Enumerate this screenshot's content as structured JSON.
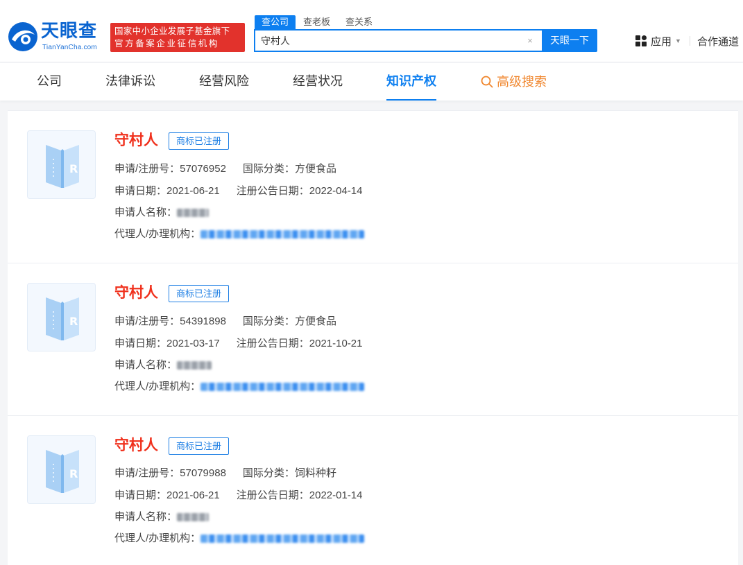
{
  "brand": {
    "name": "天眼查",
    "domain": "TianYanCha.com",
    "color": "#0a64d0"
  },
  "badge": {
    "line1": "国家中小企业发展子基金旗下",
    "line2": "官方备案企业征信机构"
  },
  "search": {
    "tabs": [
      "查公司",
      "查老板",
      "查关系"
    ],
    "value": "守村人",
    "button": "天眼一下"
  },
  "header_right": {
    "apps": "应用",
    "partner": "合作通道"
  },
  "nav": {
    "items": [
      "公司",
      "法律诉讼",
      "经营风险",
      "经营状况",
      "知识产权"
    ],
    "active": "知识产权",
    "advanced": "高级搜索"
  },
  "labels": {
    "reg_no": "申请/注册号：",
    "intl_class": "国际分类：",
    "apply_date": "申请日期：",
    "announce_date": "注册公告日期：",
    "applicant": "申请人名称：",
    "agent": "代理人/办理机构："
  },
  "results": [
    {
      "name": "守村人",
      "status": "商标已注册",
      "reg_no": "57076952",
      "intl_class": "方便食品",
      "apply_date": "2021-06-21",
      "announce_date": "2022-04-14"
    },
    {
      "name": "守村人",
      "status": "商标已注册",
      "reg_no": "54391898",
      "intl_class": "方便食品",
      "apply_date": "2021-03-17",
      "announce_date": "2021-10-21"
    },
    {
      "name": "守村人",
      "status": "商标已注册",
      "reg_no": "57079988",
      "intl_class": "饲料种籽",
      "apply_date": "2021-06-21",
      "announce_date": "2022-01-14"
    }
  ]
}
